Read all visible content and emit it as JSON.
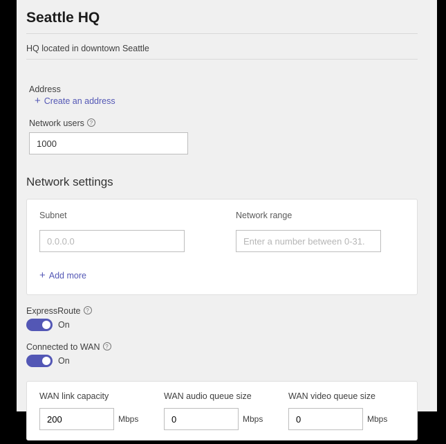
{
  "title": "Seattle HQ",
  "description": "HQ located in downtown Seattle",
  "address": {
    "label": "Address",
    "create_link": "Create an address"
  },
  "network_users": {
    "label": "Network users",
    "value": "1000"
  },
  "network_settings": {
    "title": "Network settings",
    "subnet_label": "Subnet",
    "subnet_placeholder": "0.0.0.0",
    "range_label": "Network range",
    "range_placeholder": "Enter a number between 0-31.",
    "add_more": "Add more"
  },
  "express_route": {
    "label": "ExpressRoute",
    "state": "On"
  },
  "connected_wan": {
    "label": "Connected to WAN",
    "state": "On"
  },
  "wan": {
    "link_capacity": {
      "label": "WAN link capacity",
      "value": "200",
      "unit": "Mbps"
    },
    "audio_queue": {
      "label": "WAN audio queue size",
      "value": "0",
      "unit": "Mbps"
    },
    "video_queue": {
      "label": "WAN video queue size",
      "value": "0",
      "unit": "Mbps"
    }
  }
}
